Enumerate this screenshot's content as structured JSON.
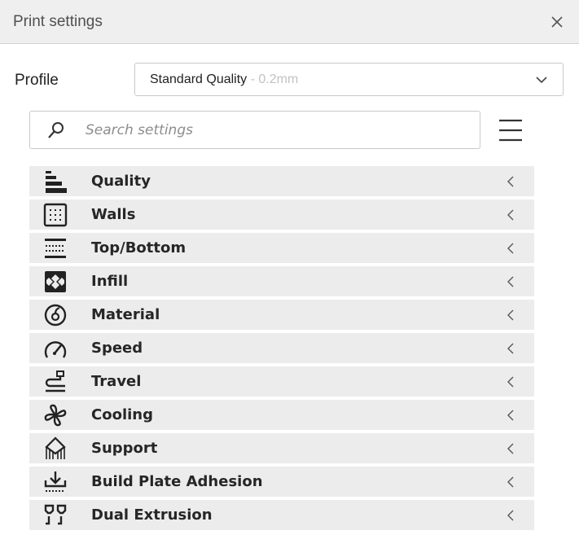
{
  "window": {
    "title": "Print settings",
    "close_icon": "close-icon"
  },
  "profile": {
    "label": "Profile",
    "value": "Standard Quality",
    "sub_value": " - 0.2mm"
  },
  "search": {
    "placeholder": "Search settings"
  },
  "categories": [
    {
      "label": "Quality",
      "icon": "quality-icon"
    },
    {
      "label": "Walls",
      "icon": "walls-icon"
    },
    {
      "label": "Top/Bottom",
      "icon": "top-bottom-icon"
    },
    {
      "label": "Infill",
      "icon": "infill-icon"
    },
    {
      "label": "Material",
      "icon": "material-icon"
    },
    {
      "label": "Speed",
      "icon": "speed-icon"
    },
    {
      "label": "Travel",
      "icon": "travel-icon"
    },
    {
      "label": "Cooling",
      "icon": "cooling-icon"
    },
    {
      "label": "Support",
      "icon": "support-icon"
    },
    {
      "label": "Build Plate Adhesion",
      "icon": "build-plate-adhesion-icon"
    },
    {
      "label": "Dual Extrusion",
      "icon": "dual-extrusion-icon"
    }
  ],
  "colors": {
    "row_background": "#ececec",
    "titlebar_background": "#efefef",
    "border": "#c9c9c9"
  }
}
